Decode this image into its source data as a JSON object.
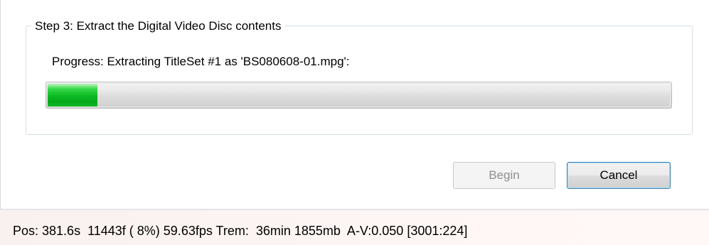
{
  "dialog": {
    "step_title": "Step 3: Extract the Digital Video Disc contents",
    "progress_label": "Progress: Extracting TitleSet #1 as 'BS080608-01.mpg':",
    "progress_fraction": 0.08
  },
  "buttons": {
    "begin_label": "Begin",
    "cancel_label": "Cancel"
  },
  "statusbar": {
    "text": "Pos: 381.6s  11443f ( 8%) 59.63fps Trem:  36min 1855mb  A-V:0.050 [3001:224]"
  },
  "colors": {
    "progress_fill": "#0bb722",
    "groupbox_border": "#d5dfe5",
    "statusbar_bg": "#fff7f5"
  }
}
